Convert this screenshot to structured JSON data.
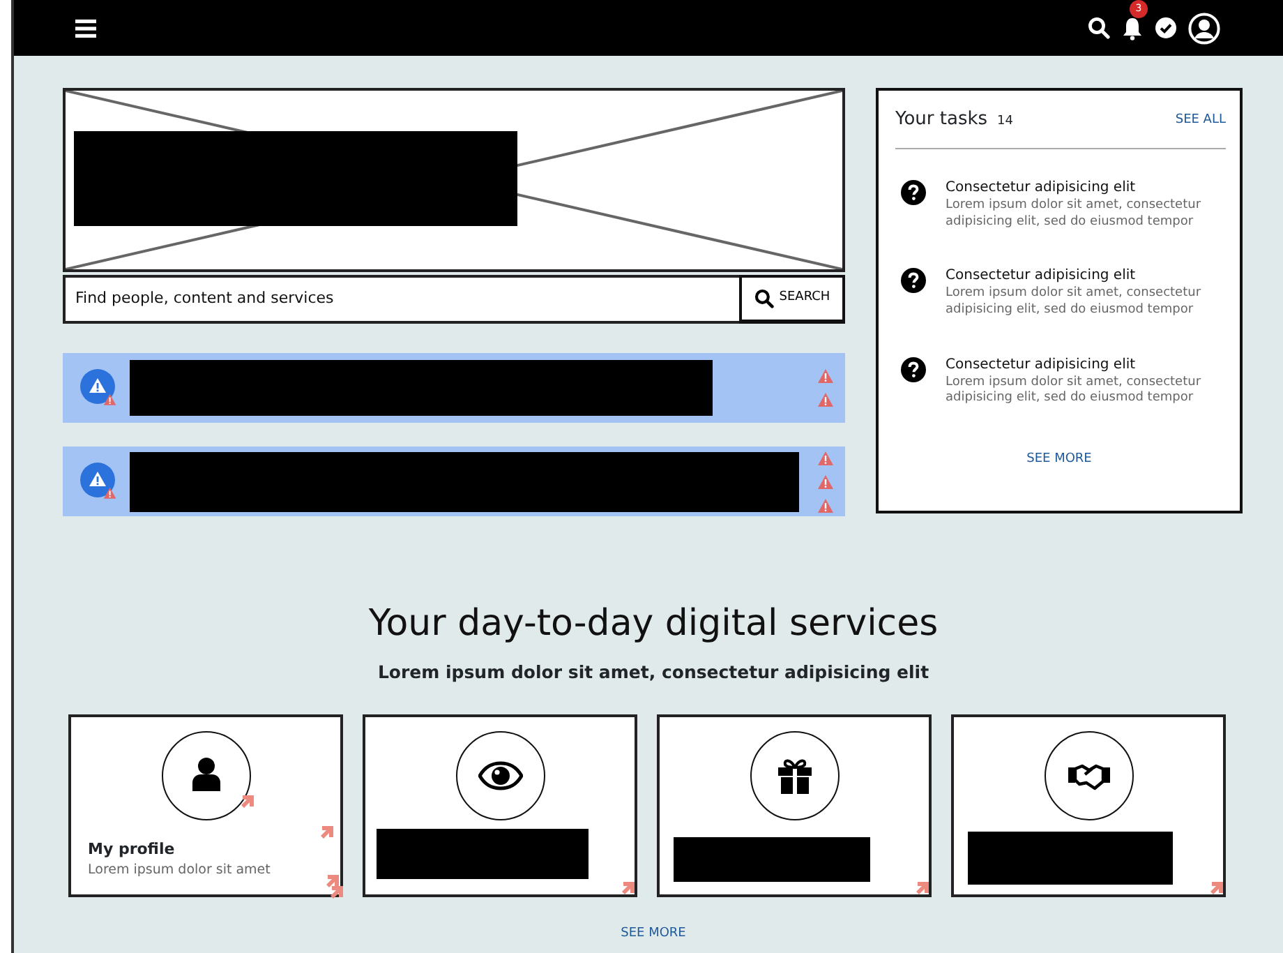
{
  "topbar": {
    "notification_count": "3"
  },
  "hero": {
    "redacted": true
  },
  "search": {
    "placeholder": "Find people, content and services",
    "button": "SEARCH"
  },
  "alerts": [
    {
      "redacted": true
    },
    {
      "redacted": true
    }
  ],
  "tasks": {
    "title": "Your tasks",
    "count": "14",
    "see_all": "SEE ALL",
    "see_more": "SEE MORE",
    "items": [
      {
        "title": "Consectetur adipisicing elit",
        "text": "Lorem ipsum dolor sit amet, consectetur adipisicing elit, sed do eiusmod tempor"
      },
      {
        "title": "Consectetur adipisicing elit",
        "text": "Lorem ipsum dolor sit amet, consectetur adipisicing elit, sed do eiusmod tempor"
      },
      {
        "title": "Consectetur adipisicing elit",
        "text": "Lorem ipsum dolor sit amet, consectetur adipisicing elit, sed do eiusmod tempor"
      }
    ]
  },
  "services": {
    "heading": "Your day-to-day digital services",
    "subtitle": "Lorem ipsum dolor sit amet, consectetur adipisicing elit",
    "see_more": "SEE MORE",
    "cards": [
      {
        "title": "My profile",
        "text": "Lorem ipsum dolor sit amet",
        "redacted": false
      },
      {
        "redacted": true
      },
      {
        "redacted": true
      },
      {
        "redacted": true
      }
    ]
  }
}
